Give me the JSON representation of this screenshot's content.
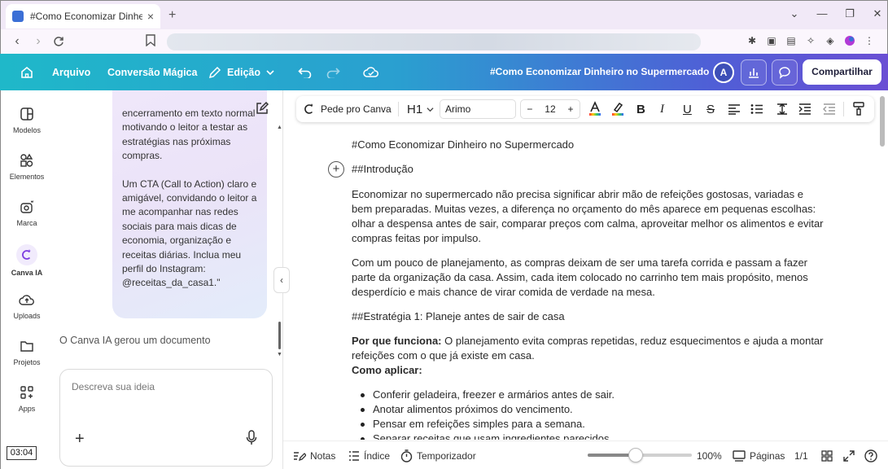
{
  "browser": {
    "tab_title": "#Como Economizar Dinheiro no Supermercado",
    "tab_close": "×",
    "new_tab": "+"
  },
  "header": {
    "menu_file": "Arquivo",
    "menu_magic": "Conversão Mágica",
    "menu_edit": "Edição",
    "doc_title": "#Como Economizar Dinheiro no Supermercado",
    "avatar_initial": "A",
    "share_label": "Compartilhar"
  },
  "rail": {
    "items": [
      {
        "label": "Modelos",
        "icon": "templates-icon"
      },
      {
        "label": "Elementos",
        "icon": "elements-icon"
      },
      {
        "label": "Marca",
        "icon": "brand-icon"
      },
      {
        "label": "Canva IA",
        "icon": "canva-ai-icon"
      },
      {
        "label": "Uploads",
        "icon": "uploads-icon"
      },
      {
        "label": "Projetos",
        "icon": "projects-icon"
      },
      {
        "label": "Apps",
        "icon": "apps-icon"
      }
    ]
  },
  "chat": {
    "bubble_p1": "encerramento em texto normal motivando o leitor a testar as estratégias nas próximas compras.",
    "bubble_p2": "Um CTA (Call to Action) claro e amigável, convidando o leitor a me acompanhar nas redes sociais para mais dicas de economia, organização e receitas diárias. Inclua meu perfil do Instagram: @receitas_da_casa1.\"",
    "generated_note": "O Canva IA gerou um documento",
    "input_placeholder": "Descreva sua ideia",
    "add_label": "+",
    "collapse_label": "‹"
  },
  "toolbar": {
    "ask_canva": "Pede pro Canva",
    "heading": "H1",
    "font": "Arimo",
    "size_minus": "−",
    "size": "12",
    "size_plus": "+",
    "bold": "B",
    "italic": "I",
    "underline": "U",
    "strike": "S"
  },
  "document": {
    "title": "#Como Economizar Dinheiro no Supermercado",
    "intro_heading": "##Introdução",
    "para1": "Economizar no supermercado não precisa significar abrir mão de refeições gostosas, variadas e bem preparadas. Muitas vezes, a diferença no orçamento do mês aparece em pequenas escolhas: olhar a despensa antes de sair, comparar preços com calma, aproveitar melhor os alimentos e evitar compras feitas por impulso.",
    "para2": "Com um pouco de planejamento, as compras deixam de ser uma tarefa corrida e passam a fazer parte da organização da casa. Assim, cada item colocado no carrinho tem mais propósito, menos desperdício e mais chance de virar comida de verdade na mesa.",
    "strategy_heading": "##Estratégia 1: Planeje antes de sair de casa",
    "why_label": "Por que funciona:",
    "why_text": " O planejamento evita compras repetidas, reduz esquecimentos e ajuda a montar refeições com o que já existe em casa.",
    "how_label": "Como aplicar:",
    "bullets": [
      "Conferir geladeira, freezer e armários antes de sair.",
      "Anotar alimentos próximos do vencimento.",
      "Pensar em refeições simples para a semana.",
      "Separar receitas que usam ingredientes parecidos."
    ]
  },
  "footer": {
    "notes": "Notas",
    "index": "Índice",
    "timer": "Temporizador",
    "zoom": "100%",
    "zoom_fraction": 0.46,
    "pages": "Páginas",
    "page_count": "1/1"
  },
  "video": {
    "timestamp": "03:04"
  },
  "colors": {
    "header_start": "#1fb8c9",
    "header_end": "#6a4fd4",
    "ai_purple": "#7d3ee0"
  }
}
